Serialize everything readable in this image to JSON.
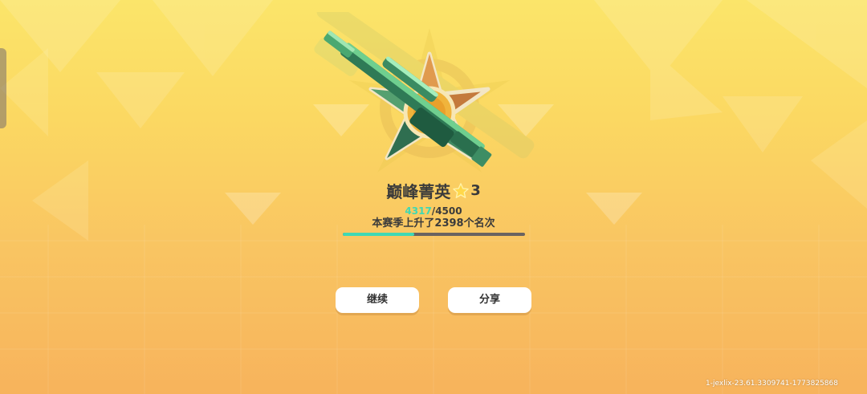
{
  "rank": {
    "title": "巅峰菁英",
    "star_count": "3",
    "star_icon": "star-icon",
    "emblem_icon": "sniper-rifle-star-badge"
  },
  "progress": {
    "current": "4317",
    "separator": "/",
    "max": "4500",
    "fraction": 0.39,
    "season_text": "本赛季上升了2398个名次"
  },
  "buttons": {
    "continue_label": "继续",
    "share_label": "分享"
  },
  "build_info": "1-jexlix-23.61.3309741-1773825868",
  "colors": {
    "background_top": "#fbe56a",
    "background_bottom": "#f7b35c",
    "accent": "#3fd8b4",
    "text": "#3b3b3b",
    "button": "#ffffff"
  }
}
